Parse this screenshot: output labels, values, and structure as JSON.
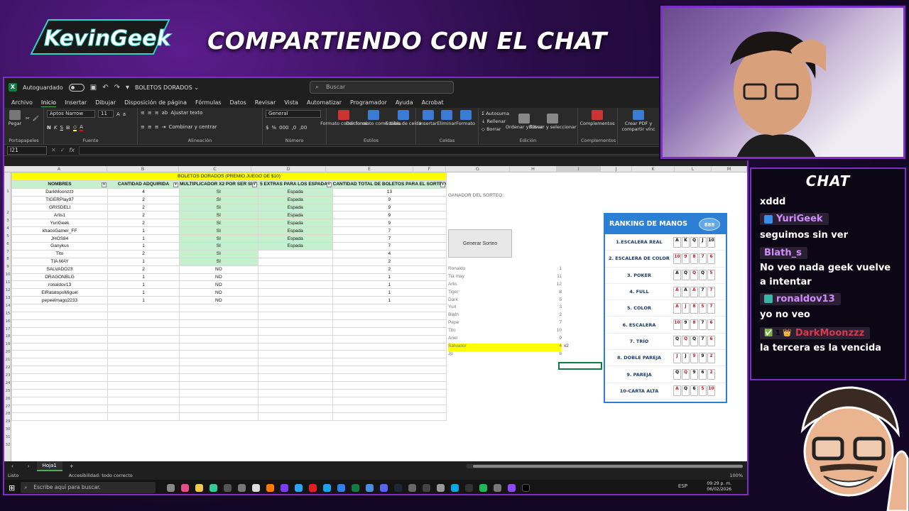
{
  "stream": {
    "logo_text": "KevinGeek",
    "title": "COMPARTIENDO CON EL CHAT"
  },
  "excel": {
    "autosave_label": "Autoguardado",
    "filename": "BOLETOS DORADOS ⌄",
    "search_placeholder": "Buscar",
    "menu": [
      "Archivo",
      "Inicio",
      "Insertar",
      "Dibujar",
      "Disposición de página",
      "Fórmulas",
      "Datos",
      "Revisar",
      "Vista",
      "Automatizar",
      "Programador",
      "Ayuda",
      "Acrobat"
    ],
    "ribbon": {
      "portapapeles": "Portapapeles",
      "pegar": "Pegar",
      "font_name": "Aptos Narrow",
      "font_size": "11",
      "fuente": "Fuente",
      "ajustar": "Ajustar texto",
      "combinar": "Combinar y centrar",
      "alineacion": "Alineación",
      "number_format": "General",
      "numero": "Número",
      "formato_cond": "Formato condicional",
      "dar_formato": "Dar formato como tabla",
      "estilos_celda": "Estilos de celda",
      "estilos": "Estilos",
      "insertar": "Insertar",
      "eliminar": "Eliminar",
      "formato": "Formato",
      "celdas": "Celdas",
      "autosuma": "Autosuma",
      "rellenar": "Rellenar",
      "borrar": "Borrar",
      "ordenar": "Ordenar y filtrar",
      "buscar": "Buscar y seleccionar",
      "edicion": "Edición",
      "complementos": "Complementos",
      "complementos_group": "Complementos",
      "crear_pdf": "Crear PDF y compartir vínc"
    },
    "name_box": "I21",
    "columns": [
      "A",
      "B",
      "C",
      "D",
      "E",
      "F",
      "G",
      "H",
      "I",
      "J",
      "K",
      "L",
      "M"
    ],
    "sheet_title": "BOLETOS DORADOS (PREMIO JUEGO DE $10)",
    "headers": [
      "NOMBRES",
      "CANTIDAD ADQUIRIDA",
      "MULTIPLICADOR X2 POR SER SUB",
      "5 EXTRAS PARA LOS ESPADAS",
      "CANTIDAD TOTAL DE BOLETOS PARA EL SORTEO"
    ],
    "rows": [
      {
        "name": "DarkMoonzzz",
        "qty": "4",
        "mult": "SI",
        "extra": "Espada",
        "total": "13"
      },
      {
        "name": "TIGERPlay97",
        "qty": "2",
        "mult": "SI",
        "extra": "Espada",
        "total": "9"
      },
      {
        "name": "GRISDELI",
        "qty": "2",
        "mult": "SI",
        "extra": "Espada",
        "total": "9"
      },
      {
        "name": "Arlis1",
        "qty": "2",
        "mult": "SI",
        "extra": "Espada",
        "total": "9"
      },
      {
        "name": "YuriGeek",
        "qty": "2",
        "mult": "SI",
        "extra": "Espada",
        "total": "9"
      },
      {
        "name": "khaosGamer_FF",
        "qty": "1",
        "mult": "SI",
        "extra": "Espada",
        "total": "7"
      },
      {
        "name": "JHOS84",
        "qty": "1",
        "mult": "SI",
        "extra": "Espada",
        "total": "7"
      },
      {
        "name": "Ganykus",
        "qty": "1",
        "mult": "SI",
        "extra": "Espada",
        "total": "7"
      },
      {
        "name": "Tito",
        "qty": "2",
        "mult": "SI",
        "extra": "",
        "total": "4"
      },
      {
        "name": "TIA MAY",
        "qty": "1",
        "mult": "SI",
        "extra": "",
        "total": "2"
      },
      {
        "name": "SALVADO23",
        "qty": "2",
        "mult": "NO",
        "extra": "",
        "total": "2"
      },
      {
        "name": "DRAGONBLG",
        "qty": "1",
        "mult": "NO",
        "extra": "",
        "total": "1"
      },
      {
        "name": "ronaldov13",
        "qty": "1",
        "mult": "NO",
        "extra": "",
        "total": "1"
      },
      {
        "name": "ElRatatopoMiguel",
        "qty": "1",
        "mult": "NO",
        "extra": "",
        "total": "1"
      },
      {
        "name": "pepeelmago2233",
        "qty": "1",
        "mult": "NO",
        "extra": "",
        "total": "1"
      }
    ],
    "ganador_label": "GANADOR DEL SORTEO:",
    "sorteo_button": "Generar Sorteo",
    "participants": [
      {
        "name": "Ronaldo",
        "value": "1"
      },
      {
        "name": "Tia may",
        "value": "11"
      },
      {
        "name": "Arlis",
        "value": "12"
      },
      {
        "name": "Tiger",
        "value": "8"
      },
      {
        "name": "Dark",
        "value": "5"
      },
      {
        "name": "Yuri",
        "value": "3"
      },
      {
        "name": "Blath",
        "value": "2"
      },
      {
        "name": "Pepe",
        "value": "7"
      },
      {
        "name": "Tito",
        "value": "10"
      },
      {
        "name": "Ariel",
        "value": "9"
      },
      {
        "name": "Salvador",
        "value": "4",
        "note": "x2",
        "highlight": true
      },
      {
        "name": "Jp",
        "value": "6"
      }
    ],
    "ranking": {
      "title": "RANKING DE MANOS",
      "badge": "888",
      "hands": [
        {
          "name": "1.ESCALERA REAL",
          "cards": [
            [
              "A",
              "b"
            ],
            [
              "K",
              "b"
            ],
            [
              "Q",
              "b"
            ],
            [
              "J",
              "b"
            ],
            [
              "10",
              "b"
            ]
          ]
        },
        {
          "name": "2. ESCALERA DE COLOR",
          "cards": [
            [
              "10",
              "r"
            ],
            [
              "9",
              "r"
            ],
            [
              "8",
              "r"
            ],
            [
              "7",
              "r"
            ],
            [
              "6",
              "r"
            ]
          ]
        },
        {
          "name": "3. POKER",
          "cards": [
            [
              "A",
              "b"
            ],
            [
              "Q",
              "b"
            ],
            [
              "Q",
              "r"
            ],
            [
              "Q",
              "b"
            ],
            [
              "5",
              "r"
            ]
          ]
        },
        {
          "name": "4. FULL",
          "cards": [
            [
              "A",
              "r"
            ],
            [
              "A",
              "b"
            ],
            [
              "A",
              "r"
            ],
            [
              "7",
              "b"
            ],
            [
              "7",
              "r"
            ]
          ]
        },
        {
          "name": "5. COLOR",
          "cards": [
            [
              "A",
              "r"
            ],
            [
              "J",
              "r"
            ],
            [
              "8",
              "r"
            ],
            [
              "5",
              "r"
            ],
            [
              "7",
              "r"
            ]
          ]
        },
        {
          "name": "6. ESCALERA",
          "cards": [
            [
              "10",
              "r"
            ],
            [
              "9",
              "b"
            ],
            [
              "8",
              "r"
            ],
            [
              "7",
              "b"
            ],
            [
              "6",
              "r"
            ]
          ]
        },
        {
          "name": "7. TRÍO",
          "cards": [
            [
              "Q",
              "b"
            ],
            [
              "Q",
              "r"
            ],
            [
              "Q",
              "b"
            ],
            [
              "7",
              "b"
            ],
            [
              "6",
              "r"
            ]
          ]
        },
        {
          "name": "8. DOBLE PAREJA",
          "cards": [
            [
              "J",
              "r"
            ],
            [
              "J",
              "b"
            ],
            [
              "9",
              "r"
            ],
            [
              "9",
              "b"
            ],
            [
              "2",
              "r"
            ]
          ]
        },
        {
          "name": "9. PAREJA",
          "cards": [
            [
              "Q",
              "b"
            ],
            [
              "Q",
              "r"
            ],
            [
              "9",
              "b"
            ],
            [
              "6",
              "b"
            ],
            [
              "2",
              "r"
            ]
          ]
        },
        {
          "name": "10-CARTA ALTA",
          "cards": [
            [
              "A",
              "r"
            ],
            [
              "Q",
              "b"
            ],
            [
              "6",
              "b"
            ],
            [
              "5",
              "r"
            ],
            [
              "10",
              "r"
            ]
          ]
        }
      ]
    },
    "sheet_tab": "Hoja1",
    "status": "Accesibilidad: todo correcto",
    "status_listo": "Listo",
    "zoom": "100%"
  },
  "taskbar": {
    "search_placeholder": "Escribe aquí para buscar.",
    "lang": "ESP",
    "time": "09:29 p. m.",
    "date": "06/02/2026"
  },
  "chat": {
    "title": "CHAT",
    "messages": [
      {
        "user": "",
        "text": "xddd"
      },
      {
        "user": "YuriGeek",
        "text": "seguimos sin ver",
        "color": "#d18cff",
        "icon": "#3a8ee6"
      },
      {
        "user": "Blath_s",
        "text": "No veo nada geek vuelve a intentar",
        "color": "#d18cff",
        "icon": ""
      },
      {
        "user": "ronaldov13",
        "text": "yo no veo",
        "color": "#d18cff",
        "icon": "#3bb3a6"
      },
      {
        "user": "DarkMoonzzz",
        "text": "la tercera es la vencida",
        "color": "#d83a4d",
        "icon": "#5fbf3a",
        "badges": "✅ 1 👑"
      }
    ]
  }
}
